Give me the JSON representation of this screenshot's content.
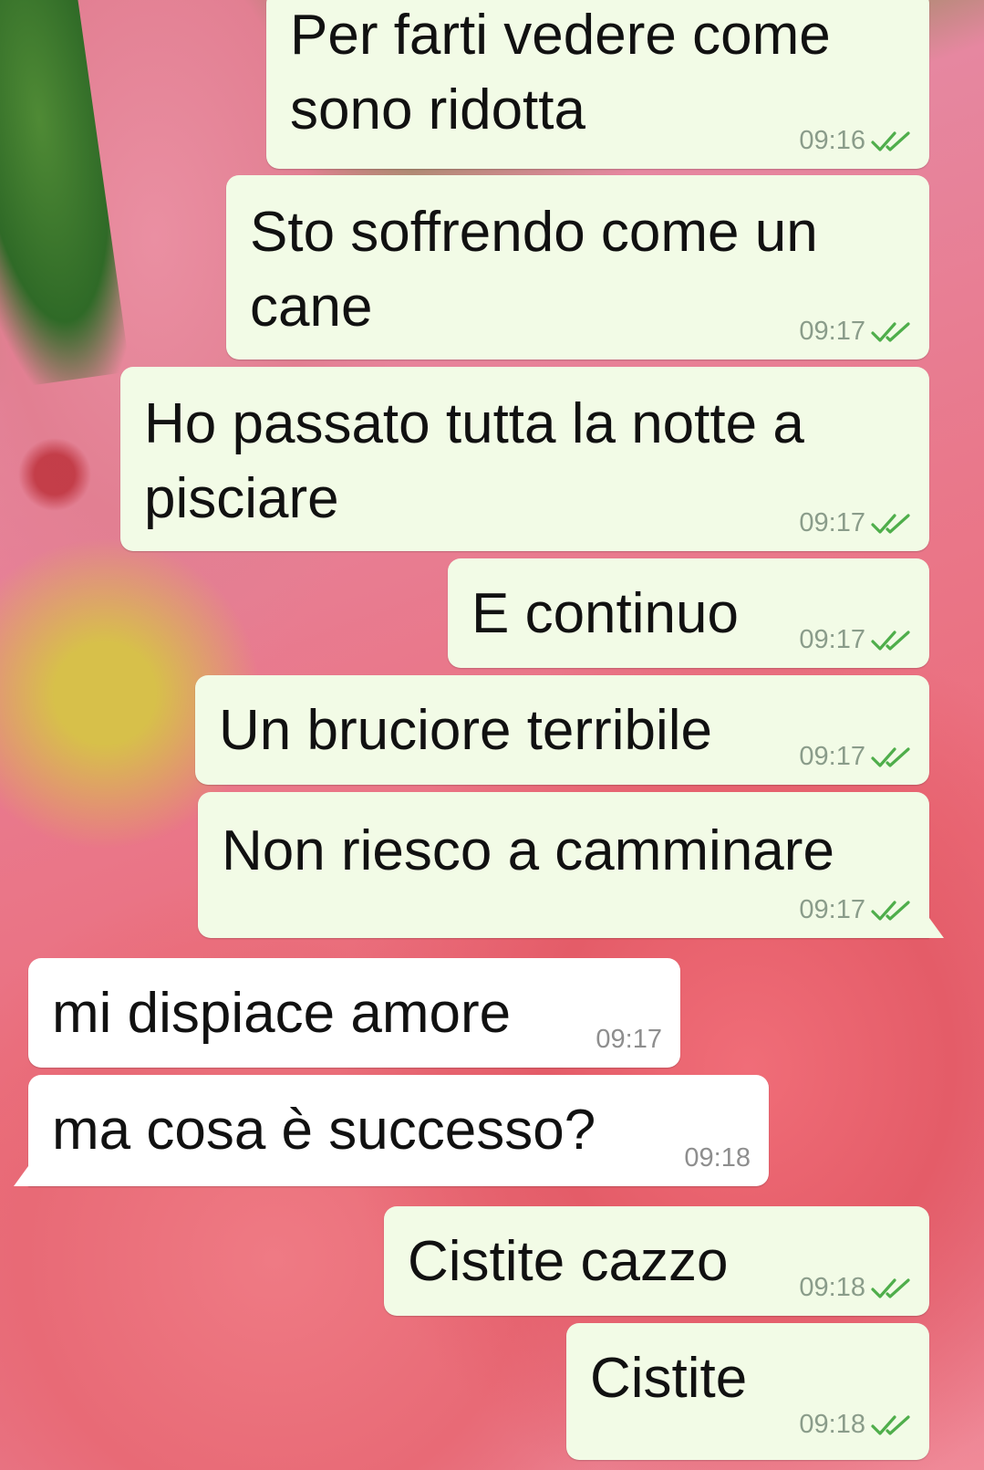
{
  "conversation": {
    "messages": [
      {
        "direction": "out",
        "text": "Per farti vedere come\nsono ridotta",
        "time": "09:16",
        "status": "read"
      },
      {
        "direction": "out",
        "text": "Sto soffrendo come un\ncane",
        "time": "09:17",
        "status": "read"
      },
      {
        "direction": "out",
        "text": "Ho passato tutta la notte a\npisciare",
        "time": "09:17",
        "status": "read"
      },
      {
        "direction": "out",
        "text": "E continuo",
        "time": "09:17",
        "status": "read"
      },
      {
        "direction": "out",
        "text": "Un bruciore terribile",
        "time": "09:17",
        "status": "read"
      },
      {
        "direction": "out",
        "text": "Non riesco a camminare",
        "time": "09:17",
        "status": "read"
      },
      {
        "direction": "in",
        "text": "mi dispiace amore",
        "time": "09:17"
      },
      {
        "direction": "in",
        "text": "ma cosa è successo?",
        "time": "09:18"
      },
      {
        "direction": "out",
        "text": "Cistite cazzo",
        "time": "09:18",
        "status": "read"
      },
      {
        "direction": "out",
        "text": "Cistite",
        "time": "09:18",
        "status": "read"
      }
    ]
  },
  "colors": {
    "outgoing_bubble": "#f2fbe6",
    "incoming_bubble": "#ffffff",
    "read_ticks": "#4fae4b",
    "wallpaper": "#e9788b"
  },
  "icons": {
    "read_receipt": "double-check-icon",
    "wallpaper": "hibiscus-flower-wallpaper"
  }
}
